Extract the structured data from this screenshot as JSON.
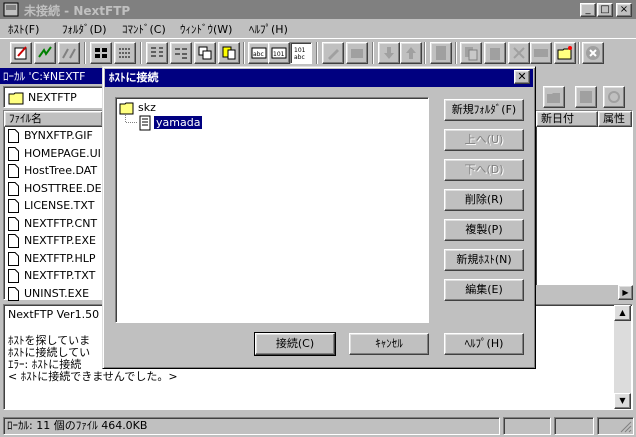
{
  "window": {
    "title": "未接続 - NextFTP"
  },
  "menu": [
    {
      "label": "ﾎｽﾄ(F)"
    },
    {
      "label": "ﾌｫﾙﾀﾞ(D)"
    },
    {
      "label": "ｺﾏﾝﾄﾞ(C)"
    },
    {
      "label": "ｳｨﾝﾄﾞｳ(W)"
    },
    {
      "label": "ﾍﾙﾌﾟ(H)"
    }
  ],
  "local": {
    "header": "ﾛｰｶﾙ 'C:¥NEXTF",
    "path": "NEXTFTP",
    "column_name": "ﾌｧｲﾙ名",
    "files": [
      "BYNXFTP.GIF",
      "HOMEPAGE.UI",
      "HostTree.DAT",
      "HOSTTREE.DE",
      "LICENSE.TXT",
      "NEXTFTP.CNT",
      "NEXTFTP.EXE",
      "NEXTFTP.HLP",
      "NEXTFTP.TXT",
      "UNINST.EXE"
    ]
  },
  "host_pane": {
    "column_date": "新日付",
    "column_attr": "属性"
  },
  "log": {
    "lines": [
      "NextFTP Ver1.50",
      "",
      "ﾎｽﾄを探していま",
      "ﾎｽﾄに接続してい",
      "ｴﾗｰ: ﾎｽﾄに接続",
      "< ﾎｽﾄに接続できませんでした。>"
    ]
  },
  "status": {
    "text": "ﾛｰｶﾙ: 11 個のﾌｧｲﾙ  464.0KB"
  },
  "dialog": {
    "title": "ﾎｽﾄに接続",
    "tree_root": "skz",
    "tree_child": "yamada",
    "buttons": {
      "new_folder": "新規ﾌｫﾙﾀﾞ(F)",
      "up": "上へ(U)",
      "down": "下へ(D)",
      "delete": "削除(R)",
      "copy": "複製(P)",
      "new_host": "新規ﾎｽﾄ(N)",
      "edit": "編集(E)",
      "connect": "接続(C)",
      "cancel": "ｷｬﾝｾﾙ",
      "help": "ﾍﾙﾌﾟ(H)"
    }
  }
}
